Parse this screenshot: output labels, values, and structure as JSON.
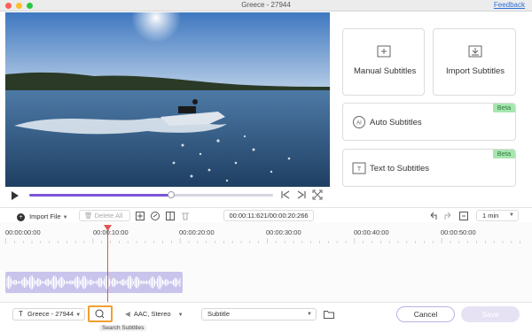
{
  "window": {
    "title": "Greece - 27944",
    "feedback_link": "Feedback"
  },
  "player": {
    "progress_fraction": 0.58,
    "icons": [
      "play-icon",
      "previous-frame-icon",
      "next-frame-icon",
      "fullscreen-icon"
    ]
  },
  "subtitle_options": {
    "manual": {
      "label": "Manual Subtitles",
      "icon": "manual-subtitles-icon"
    },
    "import": {
      "label": "Import Subtitles",
      "icon": "import-subtitles-icon"
    },
    "auto": {
      "label": "Auto Subtitles",
      "badge": "Beta",
      "icon": "auto-subtitles-icon"
    },
    "text_to": {
      "label": "Text to Subtitles",
      "badge": "Beta",
      "icon": "text-to-subtitles-icon"
    }
  },
  "timeline_toolbar": {
    "import_file": "Import File",
    "delete_all": "Delete All",
    "timecode": "00:00:11:621/00:00:20:266",
    "zoom": "1 min"
  },
  "timeline": {
    "ticks": [
      "00:00:00:00",
      "00:00:10:00",
      "00:00:20:00",
      "00:00:30:00",
      "00:00:40:00",
      "00:00:50:00"
    ]
  },
  "bottom_bar": {
    "track_select": "Greece - 27944",
    "search_tooltip": "Search Subtitles",
    "audio_select": "AAC, Stereo",
    "subtitle_select": "Subtitle",
    "cancel": "Cancel",
    "save": "Save"
  },
  "colors": {
    "accent": "#7a56d6",
    "playhead": "#e05555",
    "beta_badge": "#a7e6b0",
    "search_highlight": "#f0a030"
  }
}
